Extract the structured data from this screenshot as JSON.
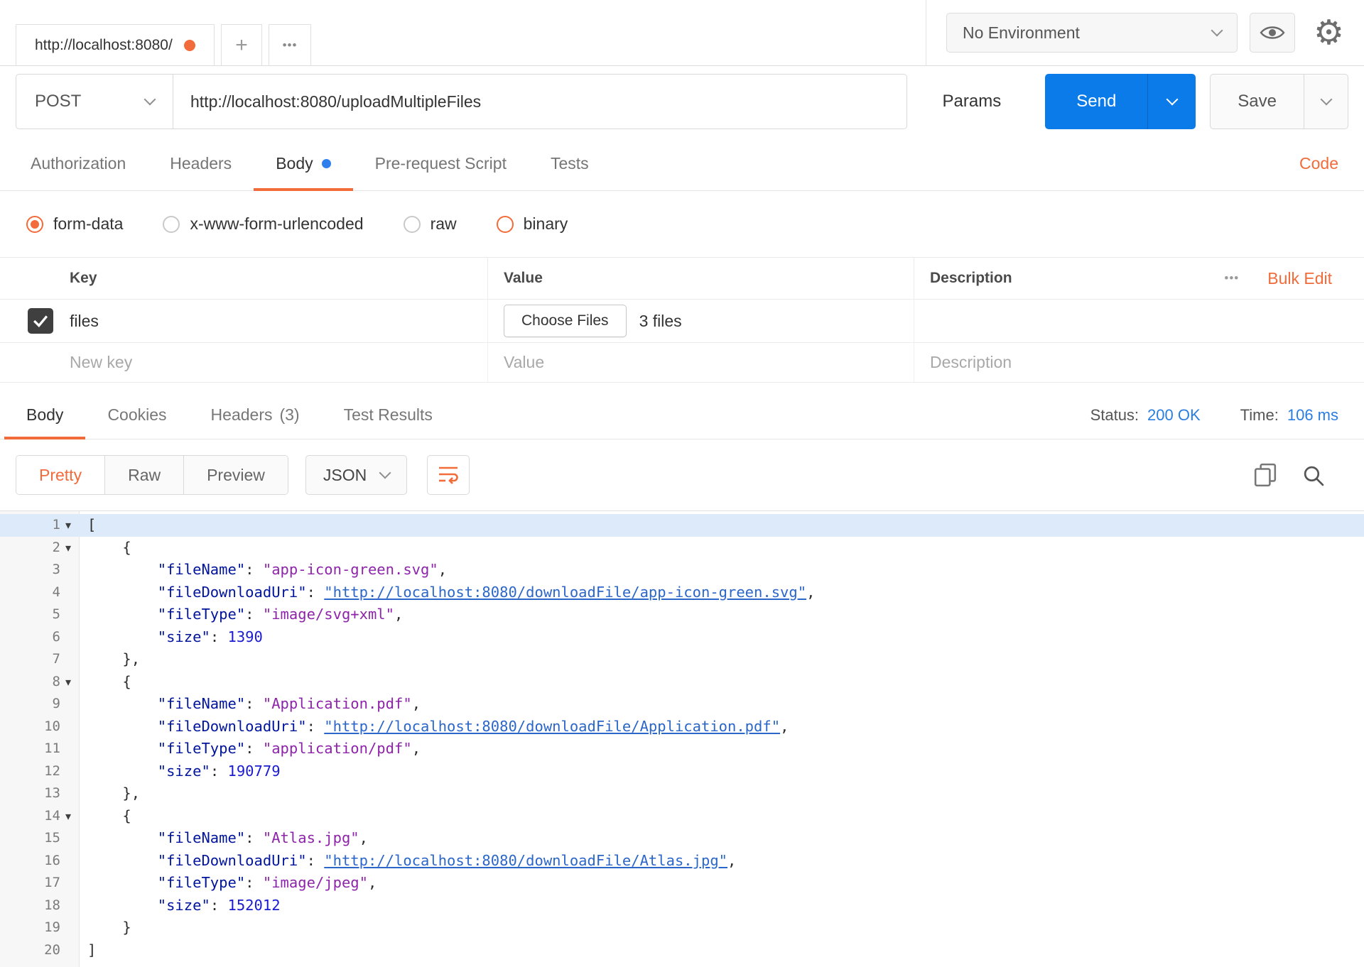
{
  "colors": {
    "accent_orange": "#f26b3a",
    "send_blue": "#0b7bea",
    "link_blue": "#2a7de1"
  },
  "topbar": {
    "tab_title": "http://localhost:8080/",
    "new_tab": "+",
    "tab_overflow": "•••",
    "environment": "No Environment"
  },
  "request": {
    "method": "POST",
    "url": "http://localhost:8080/uploadMultipleFiles",
    "params": "Params",
    "send": "Send",
    "save": "Save"
  },
  "request_tabs": {
    "items": [
      "Authorization",
      "Headers",
      "Body",
      "Pre-request Script",
      "Tests"
    ],
    "active": "Body",
    "code_link": "Code"
  },
  "body_modes": {
    "options": [
      "form-data",
      "x-www-form-urlencoded",
      "raw",
      "binary"
    ],
    "selected": "form-data"
  },
  "form_table": {
    "columns": [
      "Key",
      "Value",
      "Description"
    ],
    "menu": "•••",
    "bulk_edit": "Bulk Edit",
    "row": {
      "key": "files",
      "choose_button": "Choose Files",
      "files_count": "3 files",
      "checked": true
    },
    "placeholders": {
      "key": "New key",
      "value": "Value",
      "description": "Description"
    }
  },
  "response": {
    "tabs": [
      "Body",
      "Cookies",
      "Headers",
      "Test Results"
    ],
    "headers_count": "(3)",
    "active_tab": "Body",
    "status_label": "Status:",
    "status_value": "200 OK",
    "time_label": "Time:",
    "time_value": "106 ms"
  },
  "viewer": {
    "modes": [
      "Pretty",
      "Raw",
      "Preview"
    ],
    "active_mode": "Pretty",
    "language": "JSON"
  },
  "code": {
    "active_line": 1,
    "fold_lines": [
      1,
      2,
      8,
      14
    ],
    "lines": [
      [
        [
          "p",
          "["
        ]
      ],
      [
        [
          "p",
          "    {"
        ]
      ],
      [
        [
          "p",
          "        "
        ],
        [
          "k",
          "\"fileName\""
        ],
        [
          "p",
          ": "
        ],
        [
          "s",
          "\"app-icon-green.svg\""
        ],
        [
          "p",
          ","
        ]
      ],
      [
        [
          "p",
          "        "
        ],
        [
          "k",
          "\"fileDownloadUri\""
        ],
        [
          "p",
          ": "
        ],
        [
          "u",
          "\"http://localhost:8080/downloadFile/app-icon-green.svg\""
        ],
        [
          "p",
          ","
        ]
      ],
      [
        [
          "p",
          "        "
        ],
        [
          "k",
          "\"fileType\""
        ],
        [
          "p",
          ": "
        ],
        [
          "s",
          "\"image/svg+xml\""
        ],
        [
          "p",
          ","
        ]
      ],
      [
        [
          "p",
          "        "
        ],
        [
          "k",
          "\"size\""
        ],
        [
          "p",
          ": "
        ],
        [
          "n",
          "1390"
        ]
      ],
      [
        [
          "p",
          "    },"
        ]
      ],
      [
        [
          "p",
          "    {"
        ]
      ],
      [
        [
          "p",
          "        "
        ],
        [
          "k",
          "\"fileName\""
        ],
        [
          "p",
          ": "
        ],
        [
          "s",
          "\"Application.pdf\""
        ],
        [
          "p",
          ","
        ]
      ],
      [
        [
          "p",
          "        "
        ],
        [
          "k",
          "\"fileDownloadUri\""
        ],
        [
          "p",
          ": "
        ],
        [
          "u",
          "\"http://localhost:8080/downloadFile/Application.pdf\""
        ],
        [
          "p",
          ","
        ]
      ],
      [
        [
          "p",
          "        "
        ],
        [
          "k",
          "\"fileType\""
        ],
        [
          "p",
          ": "
        ],
        [
          "s",
          "\"application/pdf\""
        ],
        [
          "p",
          ","
        ]
      ],
      [
        [
          "p",
          "        "
        ],
        [
          "k",
          "\"size\""
        ],
        [
          "p",
          ": "
        ],
        [
          "n",
          "190779"
        ]
      ],
      [
        [
          "p",
          "    },"
        ]
      ],
      [
        [
          "p",
          "    {"
        ]
      ],
      [
        [
          "p",
          "        "
        ],
        [
          "k",
          "\"fileName\""
        ],
        [
          "p",
          ": "
        ],
        [
          "s",
          "\"Atlas.jpg\""
        ],
        [
          "p",
          ","
        ]
      ],
      [
        [
          "p",
          "        "
        ],
        [
          "k",
          "\"fileDownloadUri\""
        ],
        [
          "p",
          ": "
        ],
        [
          "u",
          "\"http://localhost:8080/downloadFile/Atlas.jpg\""
        ],
        [
          "p",
          ","
        ]
      ],
      [
        [
          "p",
          "        "
        ],
        [
          "k",
          "\"fileType\""
        ],
        [
          "p",
          ": "
        ],
        [
          "s",
          "\"image/jpeg\""
        ],
        [
          "p",
          ","
        ]
      ],
      [
        [
          "p",
          "        "
        ],
        [
          "k",
          "\"size\""
        ],
        [
          "p",
          ": "
        ],
        [
          "n",
          "152012"
        ]
      ],
      [
        [
          "p",
          "    }"
        ]
      ],
      [
        [
          "p",
          "]"
        ]
      ]
    ]
  }
}
